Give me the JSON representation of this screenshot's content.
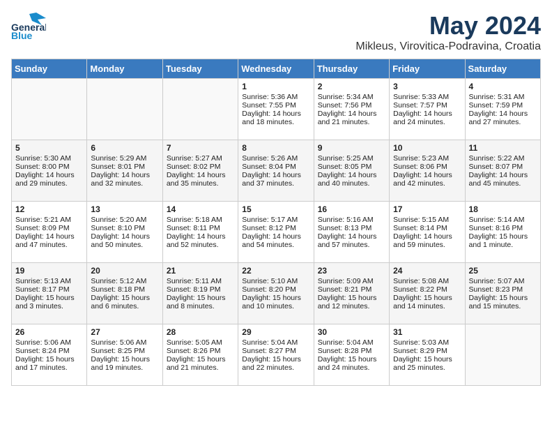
{
  "header": {
    "logo_line1": "General",
    "logo_line2": "Blue",
    "month_year": "May 2024",
    "location": "Mikleus, Virovitica-Podravina, Croatia"
  },
  "days_of_week": [
    "Sunday",
    "Monday",
    "Tuesday",
    "Wednesday",
    "Thursday",
    "Friday",
    "Saturday"
  ],
  "weeks": [
    [
      {
        "day": "",
        "content": ""
      },
      {
        "day": "",
        "content": ""
      },
      {
        "day": "",
        "content": ""
      },
      {
        "day": "1",
        "content": "Sunrise: 5:36 AM\nSunset: 7:55 PM\nDaylight: 14 hours\nand 18 minutes."
      },
      {
        "day": "2",
        "content": "Sunrise: 5:34 AM\nSunset: 7:56 PM\nDaylight: 14 hours\nand 21 minutes."
      },
      {
        "day": "3",
        "content": "Sunrise: 5:33 AM\nSunset: 7:57 PM\nDaylight: 14 hours\nand 24 minutes."
      },
      {
        "day": "4",
        "content": "Sunrise: 5:31 AM\nSunset: 7:59 PM\nDaylight: 14 hours\nand 27 minutes."
      }
    ],
    [
      {
        "day": "5",
        "content": "Sunrise: 5:30 AM\nSunset: 8:00 PM\nDaylight: 14 hours\nand 29 minutes."
      },
      {
        "day": "6",
        "content": "Sunrise: 5:29 AM\nSunset: 8:01 PM\nDaylight: 14 hours\nand 32 minutes."
      },
      {
        "day": "7",
        "content": "Sunrise: 5:27 AM\nSunset: 8:02 PM\nDaylight: 14 hours\nand 35 minutes."
      },
      {
        "day": "8",
        "content": "Sunrise: 5:26 AM\nSunset: 8:04 PM\nDaylight: 14 hours\nand 37 minutes."
      },
      {
        "day": "9",
        "content": "Sunrise: 5:25 AM\nSunset: 8:05 PM\nDaylight: 14 hours\nand 40 minutes."
      },
      {
        "day": "10",
        "content": "Sunrise: 5:23 AM\nSunset: 8:06 PM\nDaylight: 14 hours\nand 42 minutes."
      },
      {
        "day": "11",
        "content": "Sunrise: 5:22 AM\nSunset: 8:07 PM\nDaylight: 14 hours\nand 45 minutes."
      }
    ],
    [
      {
        "day": "12",
        "content": "Sunrise: 5:21 AM\nSunset: 8:09 PM\nDaylight: 14 hours\nand 47 minutes."
      },
      {
        "day": "13",
        "content": "Sunrise: 5:20 AM\nSunset: 8:10 PM\nDaylight: 14 hours\nand 50 minutes."
      },
      {
        "day": "14",
        "content": "Sunrise: 5:18 AM\nSunset: 8:11 PM\nDaylight: 14 hours\nand 52 minutes."
      },
      {
        "day": "15",
        "content": "Sunrise: 5:17 AM\nSunset: 8:12 PM\nDaylight: 14 hours\nand 54 minutes."
      },
      {
        "day": "16",
        "content": "Sunrise: 5:16 AM\nSunset: 8:13 PM\nDaylight: 14 hours\nand 57 minutes."
      },
      {
        "day": "17",
        "content": "Sunrise: 5:15 AM\nSunset: 8:14 PM\nDaylight: 14 hours\nand 59 minutes."
      },
      {
        "day": "18",
        "content": "Sunrise: 5:14 AM\nSunset: 8:16 PM\nDaylight: 15 hours\nand 1 minute."
      }
    ],
    [
      {
        "day": "19",
        "content": "Sunrise: 5:13 AM\nSunset: 8:17 PM\nDaylight: 15 hours\nand 3 minutes."
      },
      {
        "day": "20",
        "content": "Sunrise: 5:12 AM\nSunset: 8:18 PM\nDaylight: 15 hours\nand 6 minutes."
      },
      {
        "day": "21",
        "content": "Sunrise: 5:11 AM\nSunset: 8:19 PM\nDaylight: 15 hours\nand 8 minutes."
      },
      {
        "day": "22",
        "content": "Sunrise: 5:10 AM\nSunset: 8:20 PM\nDaylight: 15 hours\nand 10 minutes."
      },
      {
        "day": "23",
        "content": "Sunrise: 5:09 AM\nSunset: 8:21 PM\nDaylight: 15 hours\nand 12 minutes."
      },
      {
        "day": "24",
        "content": "Sunrise: 5:08 AM\nSunset: 8:22 PM\nDaylight: 15 hours\nand 14 minutes."
      },
      {
        "day": "25",
        "content": "Sunrise: 5:07 AM\nSunset: 8:23 PM\nDaylight: 15 hours\nand 15 minutes."
      }
    ],
    [
      {
        "day": "26",
        "content": "Sunrise: 5:06 AM\nSunset: 8:24 PM\nDaylight: 15 hours\nand 17 minutes."
      },
      {
        "day": "27",
        "content": "Sunrise: 5:06 AM\nSunset: 8:25 PM\nDaylight: 15 hours\nand 19 minutes."
      },
      {
        "day": "28",
        "content": "Sunrise: 5:05 AM\nSunset: 8:26 PM\nDaylight: 15 hours\nand 21 minutes."
      },
      {
        "day": "29",
        "content": "Sunrise: 5:04 AM\nSunset: 8:27 PM\nDaylight: 15 hours\nand 22 minutes."
      },
      {
        "day": "30",
        "content": "Sunrise: 5:04 AM\nSunset: 8:28 PM\nDaylight: 15 hours\nand 24 minutes."
      },
      {
        "day": "31",
        "content": "Sunrise: 5:03 AM\nSunset: 8:29 PM\nDaylight: 15 hours\nand 25 minutes."
      },
      {
        "day": "",
        "content": ""
      }
    ]
  ]
}
